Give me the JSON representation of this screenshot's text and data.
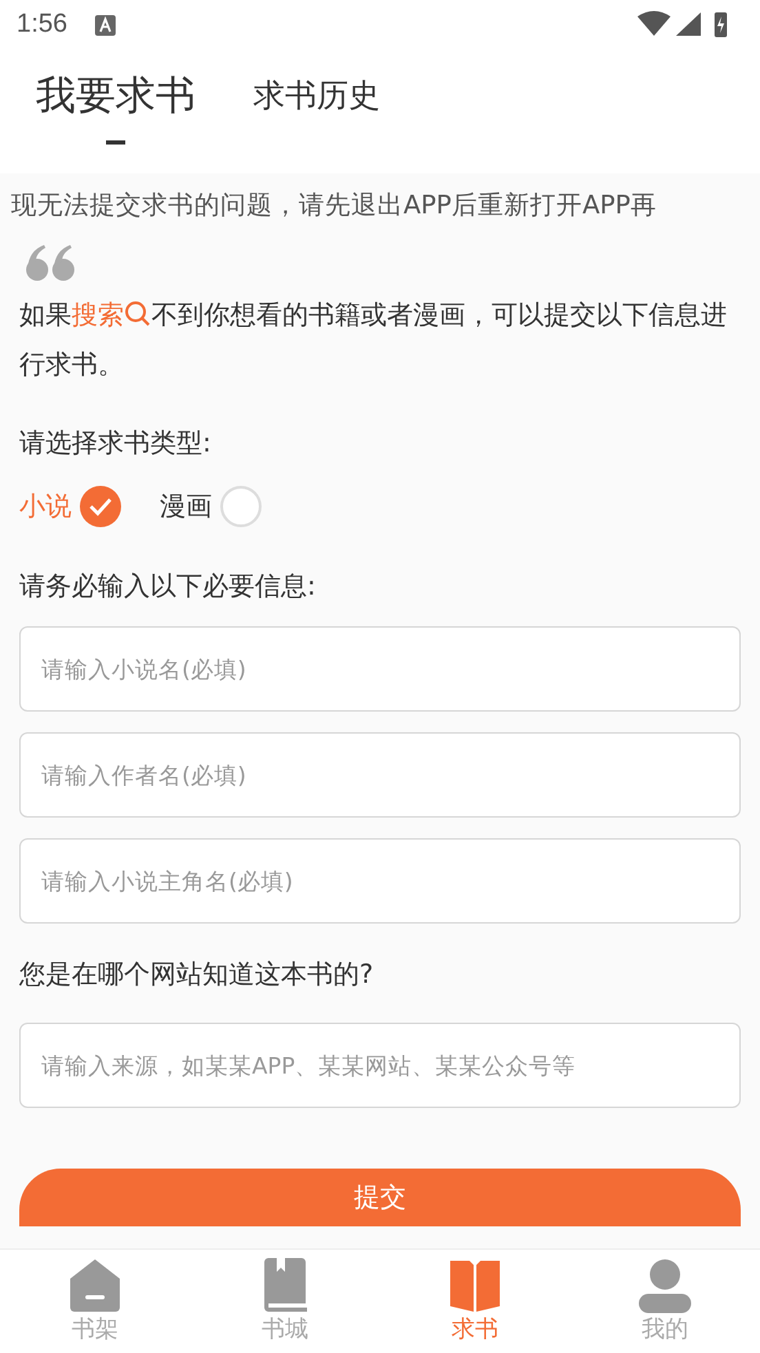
{
  "status_bar": {
    "time": "1:56"
  },
  "tabs": [
    {
      "label": "我要求书",
      "selected": true
    },
    {
      "label": "求书历史",
      "selected": false
    }
  ],
  "notice": "现无法提交求书的问题，请先退出APP后重新打开APP再",
  "intro": {
    "before": "如果",
    "link": "搜索",
    "after": "不到你想看的书籍或者漫画，可以提交以下信息进行求书。"
  },
  "type_prompt": "请选择求书类型:",
  "types": [
    {
      "label": "小说",
      "selected": true
    },
    {
      "label": "漫画",
      "selected": false
    }
  ],
  "fields_prompt": "请务必输入以下必要信息:",
  "fields": [
    {
      "placeholder": "请输入小说名(必填)"
    },
    {
      "placeholder": "请输入作者名(必填)"
    },
    {
      "placeholder": "请输入小说主角名(必填)"
    }
  ],
  "source_prompt": "您是在哪个网站知道这本书的?",
  "source_field": {
    "placeholder": "请输入来源，如某某APP、某某网站、某某公众号等"
  },
  "submit": "提交",
  "nav": [
    {
      "label": "书架",
      "kind": "shelf",
      "selected": false
    },
    {
      "label": "书城",
      "kind": "store",
      "selected": false
    },
    {
      "label": "求书",
      "kind": "request",
      "selected": true
    },
    {
      "label": "我的",
      "kind": "me",
      "selected": false
    }
  ]
}
